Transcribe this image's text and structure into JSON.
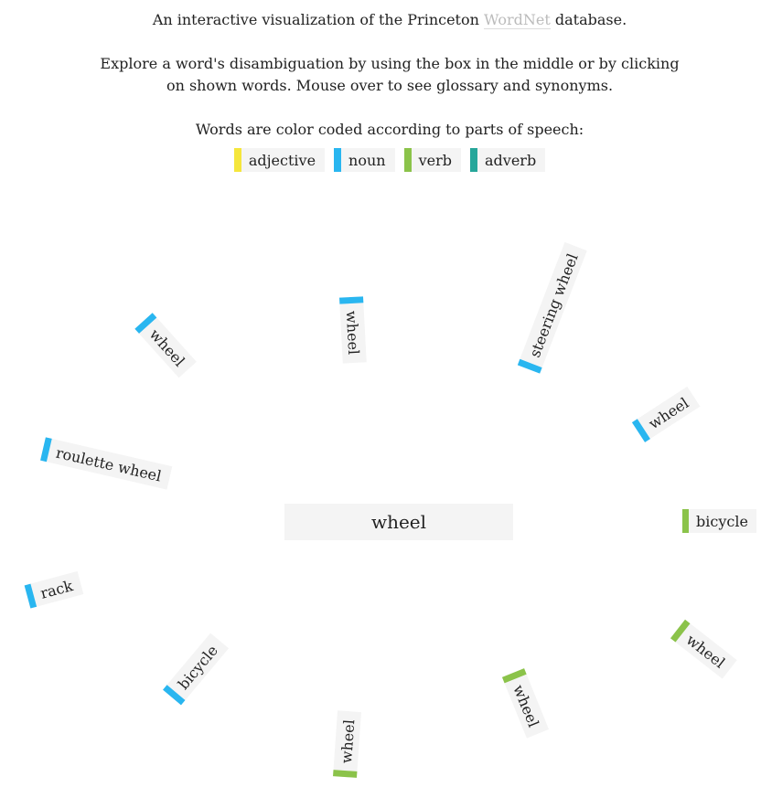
{
  "header": {
    "line1_before": "An interactive visualization of the Princeton ",
    "line1_link": "WordNet",
    "line1_after": " database.",
    "line2a": "Explore a word's disambiguation by using the box in the middle or by clicking",
    "line2b": "on shown words. Mouse over to see glossary and synonyms.",
    "line3": "Words are color coded according to parts of speech:"
  },
  "legend": [
    {
      "label": "adjective",
      "color": "#f5e63c"
    },
    {
      "label": "noun",
      "color": "#29b6f0"
    },
    {
      "label": "verb",
      "color": "#8bc34a"
    },
    {
      "label": "adverb",
      "color": "#26a69a"
    }
  ],
  "search": {
    "value": "wheel"
  },
  "words": [
    {
      "text": "wheel",
      "pos": "noun"
    },
    {
      "text": "wheel",
      "pos": "noun"
    },
    {
      "text": "steering wheel",
      "pos": "noun"
    },
    {
      "text": "wheel",
      "pos": "noun"
    },
    {
      "text": "roulette wheel",
      "pos": "noun"
    },
    {
      "text": "bicycle",
      "pos": "verb"
    },
    {
      "text": "rack",
      "pos": "noun"
    },
    {
      "text": "wheel",
      "pos": "verb"
    },
    {
      "text": "bicycle",
      "pos": "noun"
    },
    {
      "text": "wheel",
      "pos": "verb"
    },
    {
      "text": "wheel",
      "pos": "verb"
    }
  ]
}
